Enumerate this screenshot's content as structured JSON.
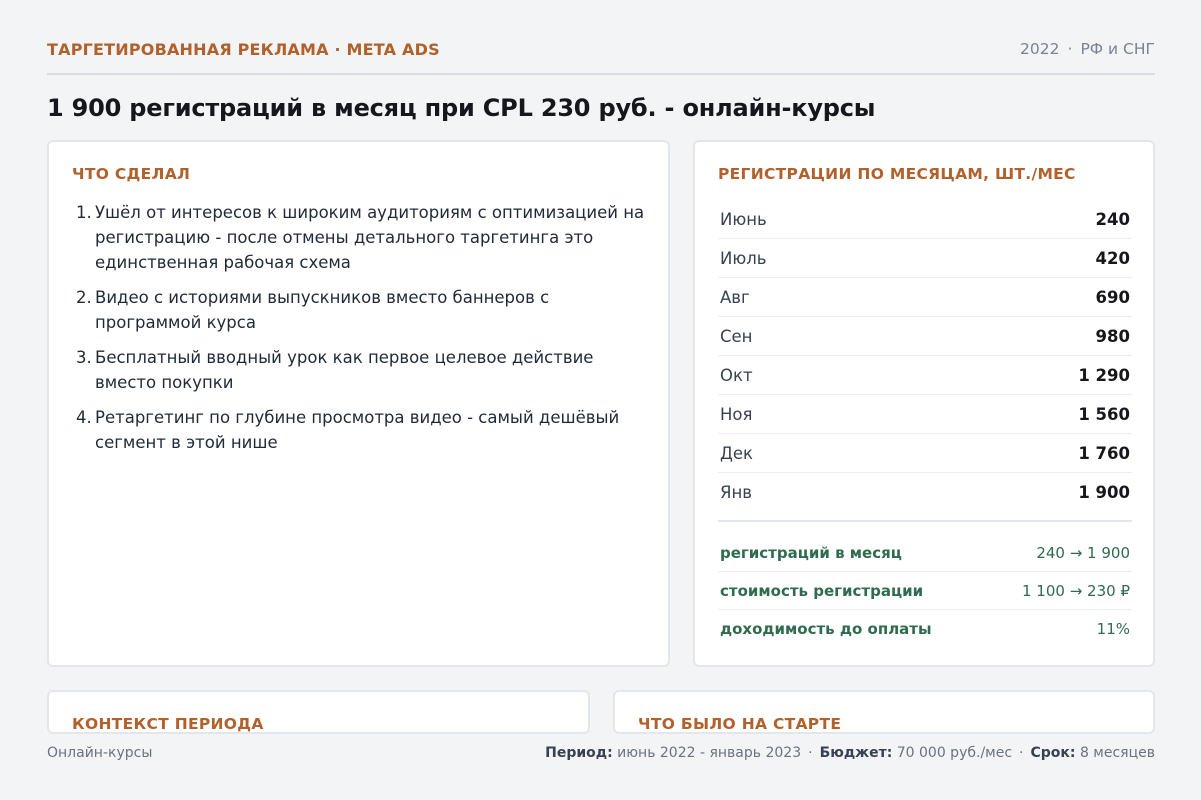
{
  "header": {
    "category": "ТАРГЕТИРОВАННАЯ РЕКЛАМА · META ADS",
    "year": "2022",
    "region": "РФ и СНГ",
    "separator": "·"
  },
  "headline": "1 900 регистраций в месяц при CPL 230 руб. - онлайн-курсы",
  "did": {
    "title": "ЧТО СДЕЛАЛ",
    "items": [
      {
        "num": "1.",
        "text": "Ушёл от интересов к широким аудиториям с оптимизацией на регистрацию - после отмены детального таргетинга это единственная рабочая схема"
      },
      {
        "num": "2.",
        "text": "Видео с историями выпускников вместо баннеров с программой курса"
      },
      {
        "num": "3.",
        "text": "Бесплатный вводный урок как первое целевое действие вместо покупки"
      },
      {
        "num": "4.",
        "text": "Ретаргетинг по глубине просмотра видео - самый дешёвый сегмент в этой нише"
      }
    ]
  },
  "registrations": {
    "title": "РЕГИСТРАЦИИ ПО МЕСЯЦАМ, ШТ./МЕС",
    "months": [
      {
        "month": "Июнь",
        "value": "240"
      },
      {
        "month": "Июль",
        "value": "420"
      },
      {
        "month": "Авг",
        "value": "690"
      },
      {
        "month": "Сен",
        "value": "980"
      },
      {
        "month": "Окт",
        "value": "1 290"
      },
      {
        "month": "Ноя",
        "value": "1 560"
      },
      {
        "month": "Дек",
        "value": "1 760"
      },
      {
        "month": "Янв",
        "value": "1 900"
      }
    ],
    "summary": [
      {
        "label": "регистраций в месяц",
        "value": "240 → 1 900"
      },
      {
        "label": "стоимость регистрации",
        "value": "1 100 → 230 ₽"
      },
      {
        "label": "доходимость до оплаты",
        "value": "11%"
      }
    ],
    "accent_color": "#2f6b4f"
  },
  "context": {
    "title": "КОНТЕКСТ ПЕРИОДА"
  },
  "start": {
    "title": "ЧТО БЫЛО НА СТАРТЕ"
  },
  "footer": {
    "niche": "Онлайн-курсы",
    "period_label": "Период:",
    "period_value": "июнь 2022 - январь 2023",
    "budget_label": "Бюджет:",
    "budget_value": "70 000 руб./мес",
    "term_label": "Срок:",
    "term_value": "8 месяцев",
    "separator": "·"
  },
  "colors": {
    "accent": "#b0612c",
    "background": "#f3f4f6",
    "card": "#ffffff"
  }
}
